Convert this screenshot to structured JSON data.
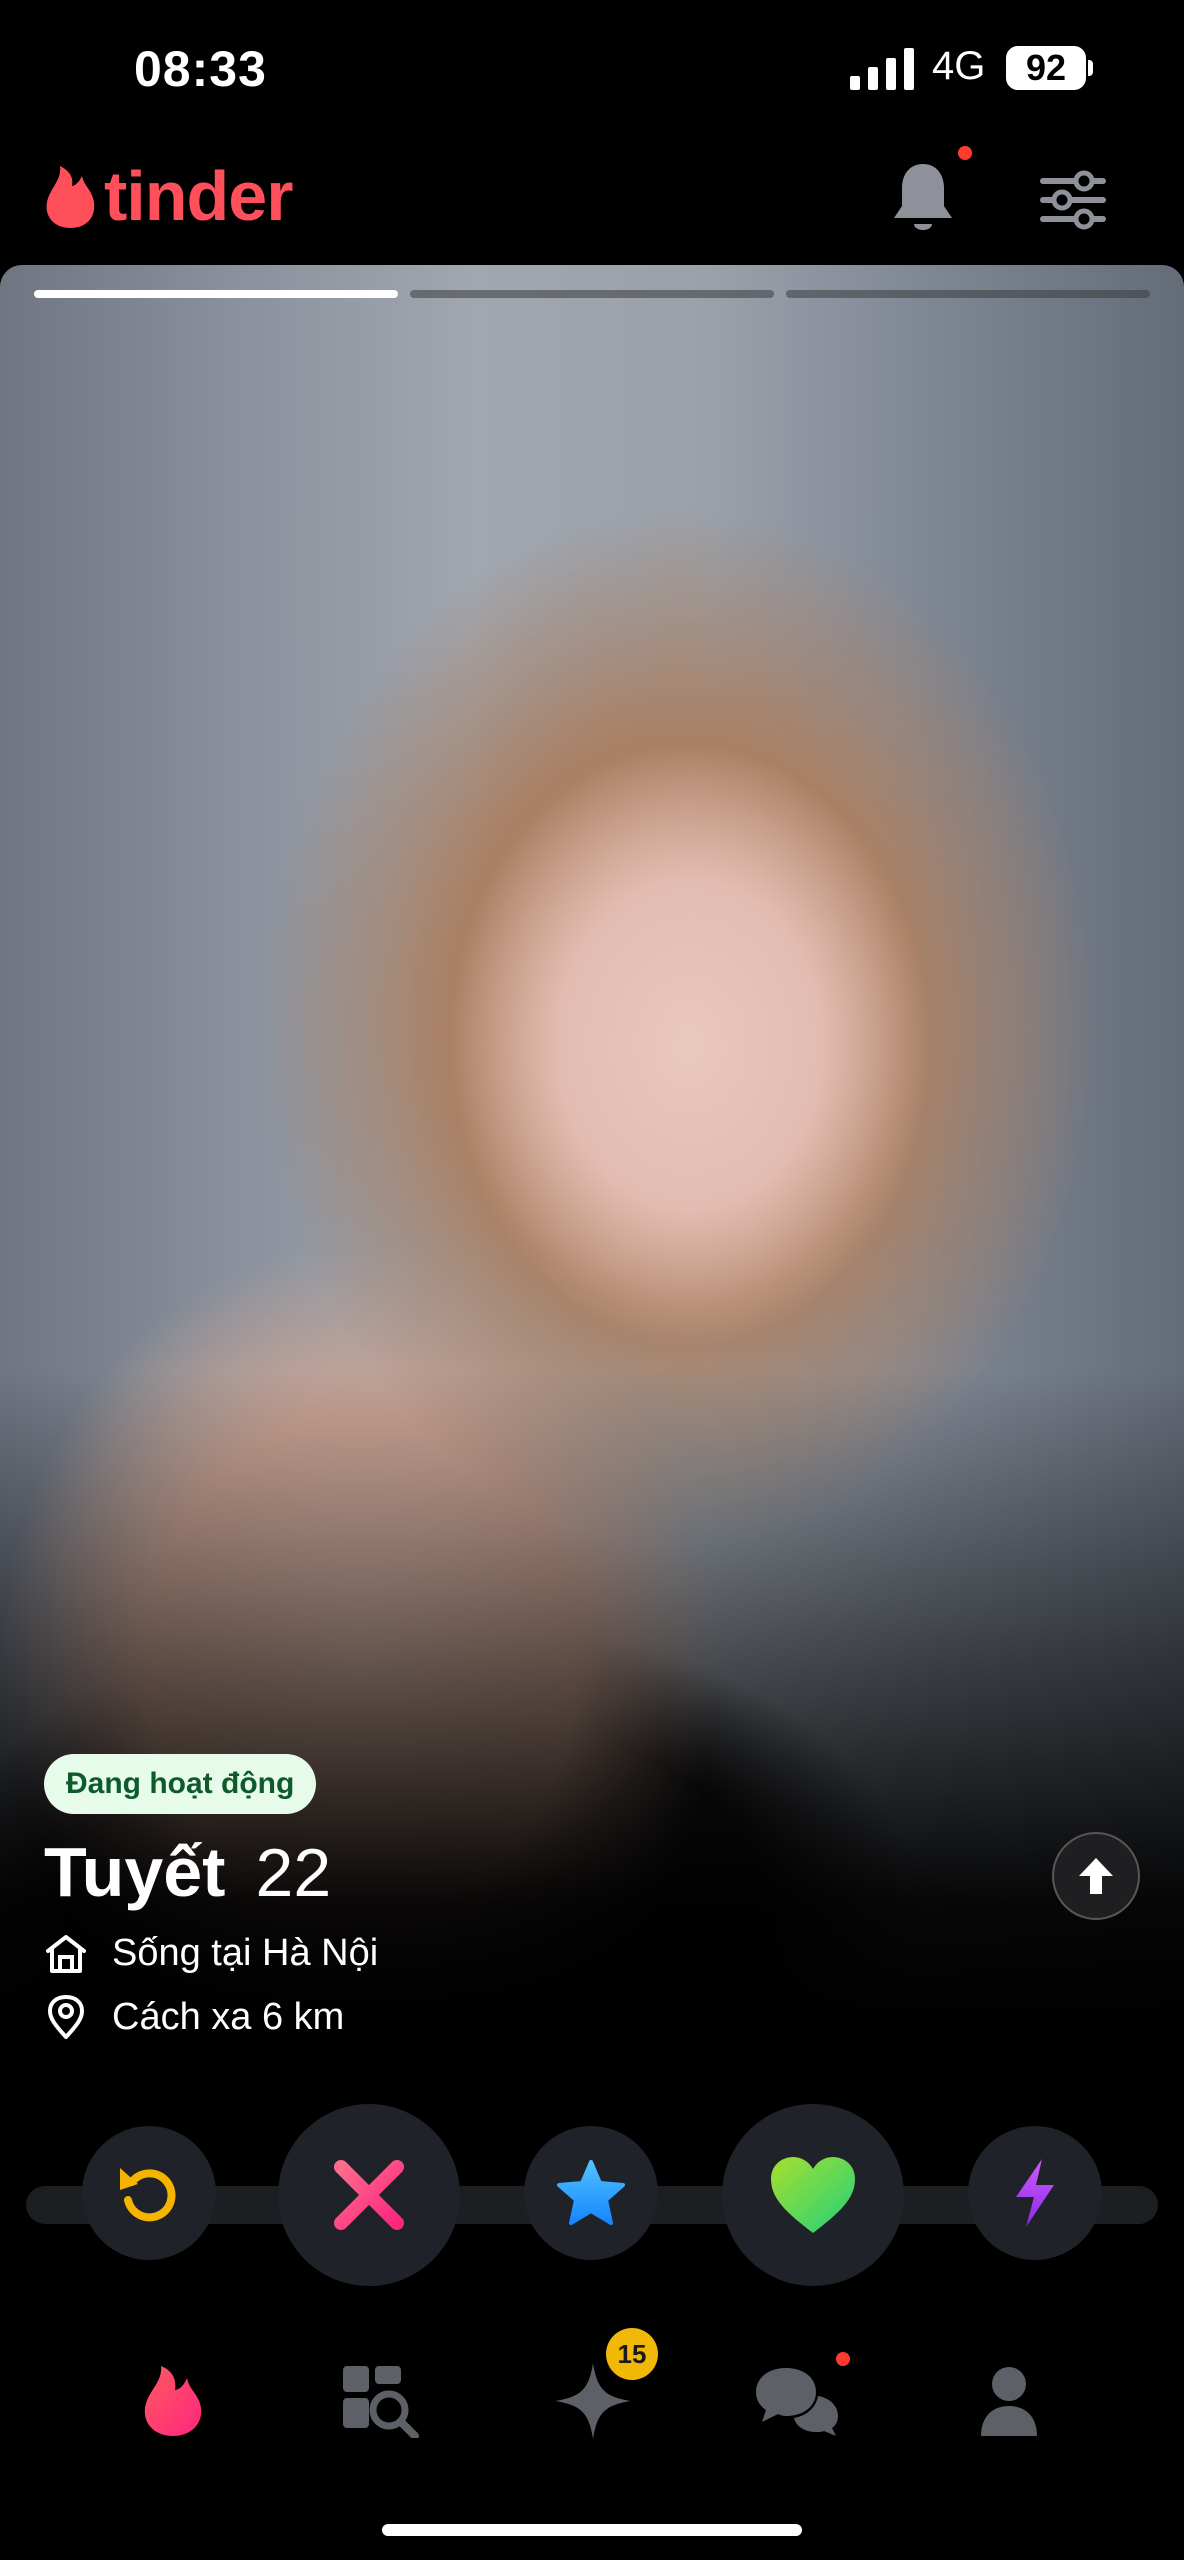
{
  "status_bar": {
    "time": "08:33",
    "network": "4G",
    "battery": "92"
  },
  "header": {
    "brand": "tinder",
    "bell_has_notification": true
  },
  "card": {
    "photo_count": 3,
    "active_photo_index": 0,
    "badge": "Đang hoạt động",
    "name": "Tuyết",
    "age": "22",
    "lives_in": "Sống tại Hà Nội",
    "distance": "Cách xa 6 km"
  },
  "actions": {
    "rewind_icon": "rewind-icon",
    "nope_icon": "close-icon",
    "superlike_icon": "star-icon",
    "like_icon": "heart-icon",
    "boost_icon": "lightning-icon"
  },
  "nav": {
    "likes_badge": "15",
    "messages_has_notification": true
  },
  "colors": {
    "brand": "#fe4f5a",
    "rewind": "#f5b400",
    "nope": "#fd267d",
    "superlike": "#1786ff",
    "like": "#21d07c",
    "boost": "#a23cf5",
    "active_badge_bg": "#e6fbe9"
  }
}
